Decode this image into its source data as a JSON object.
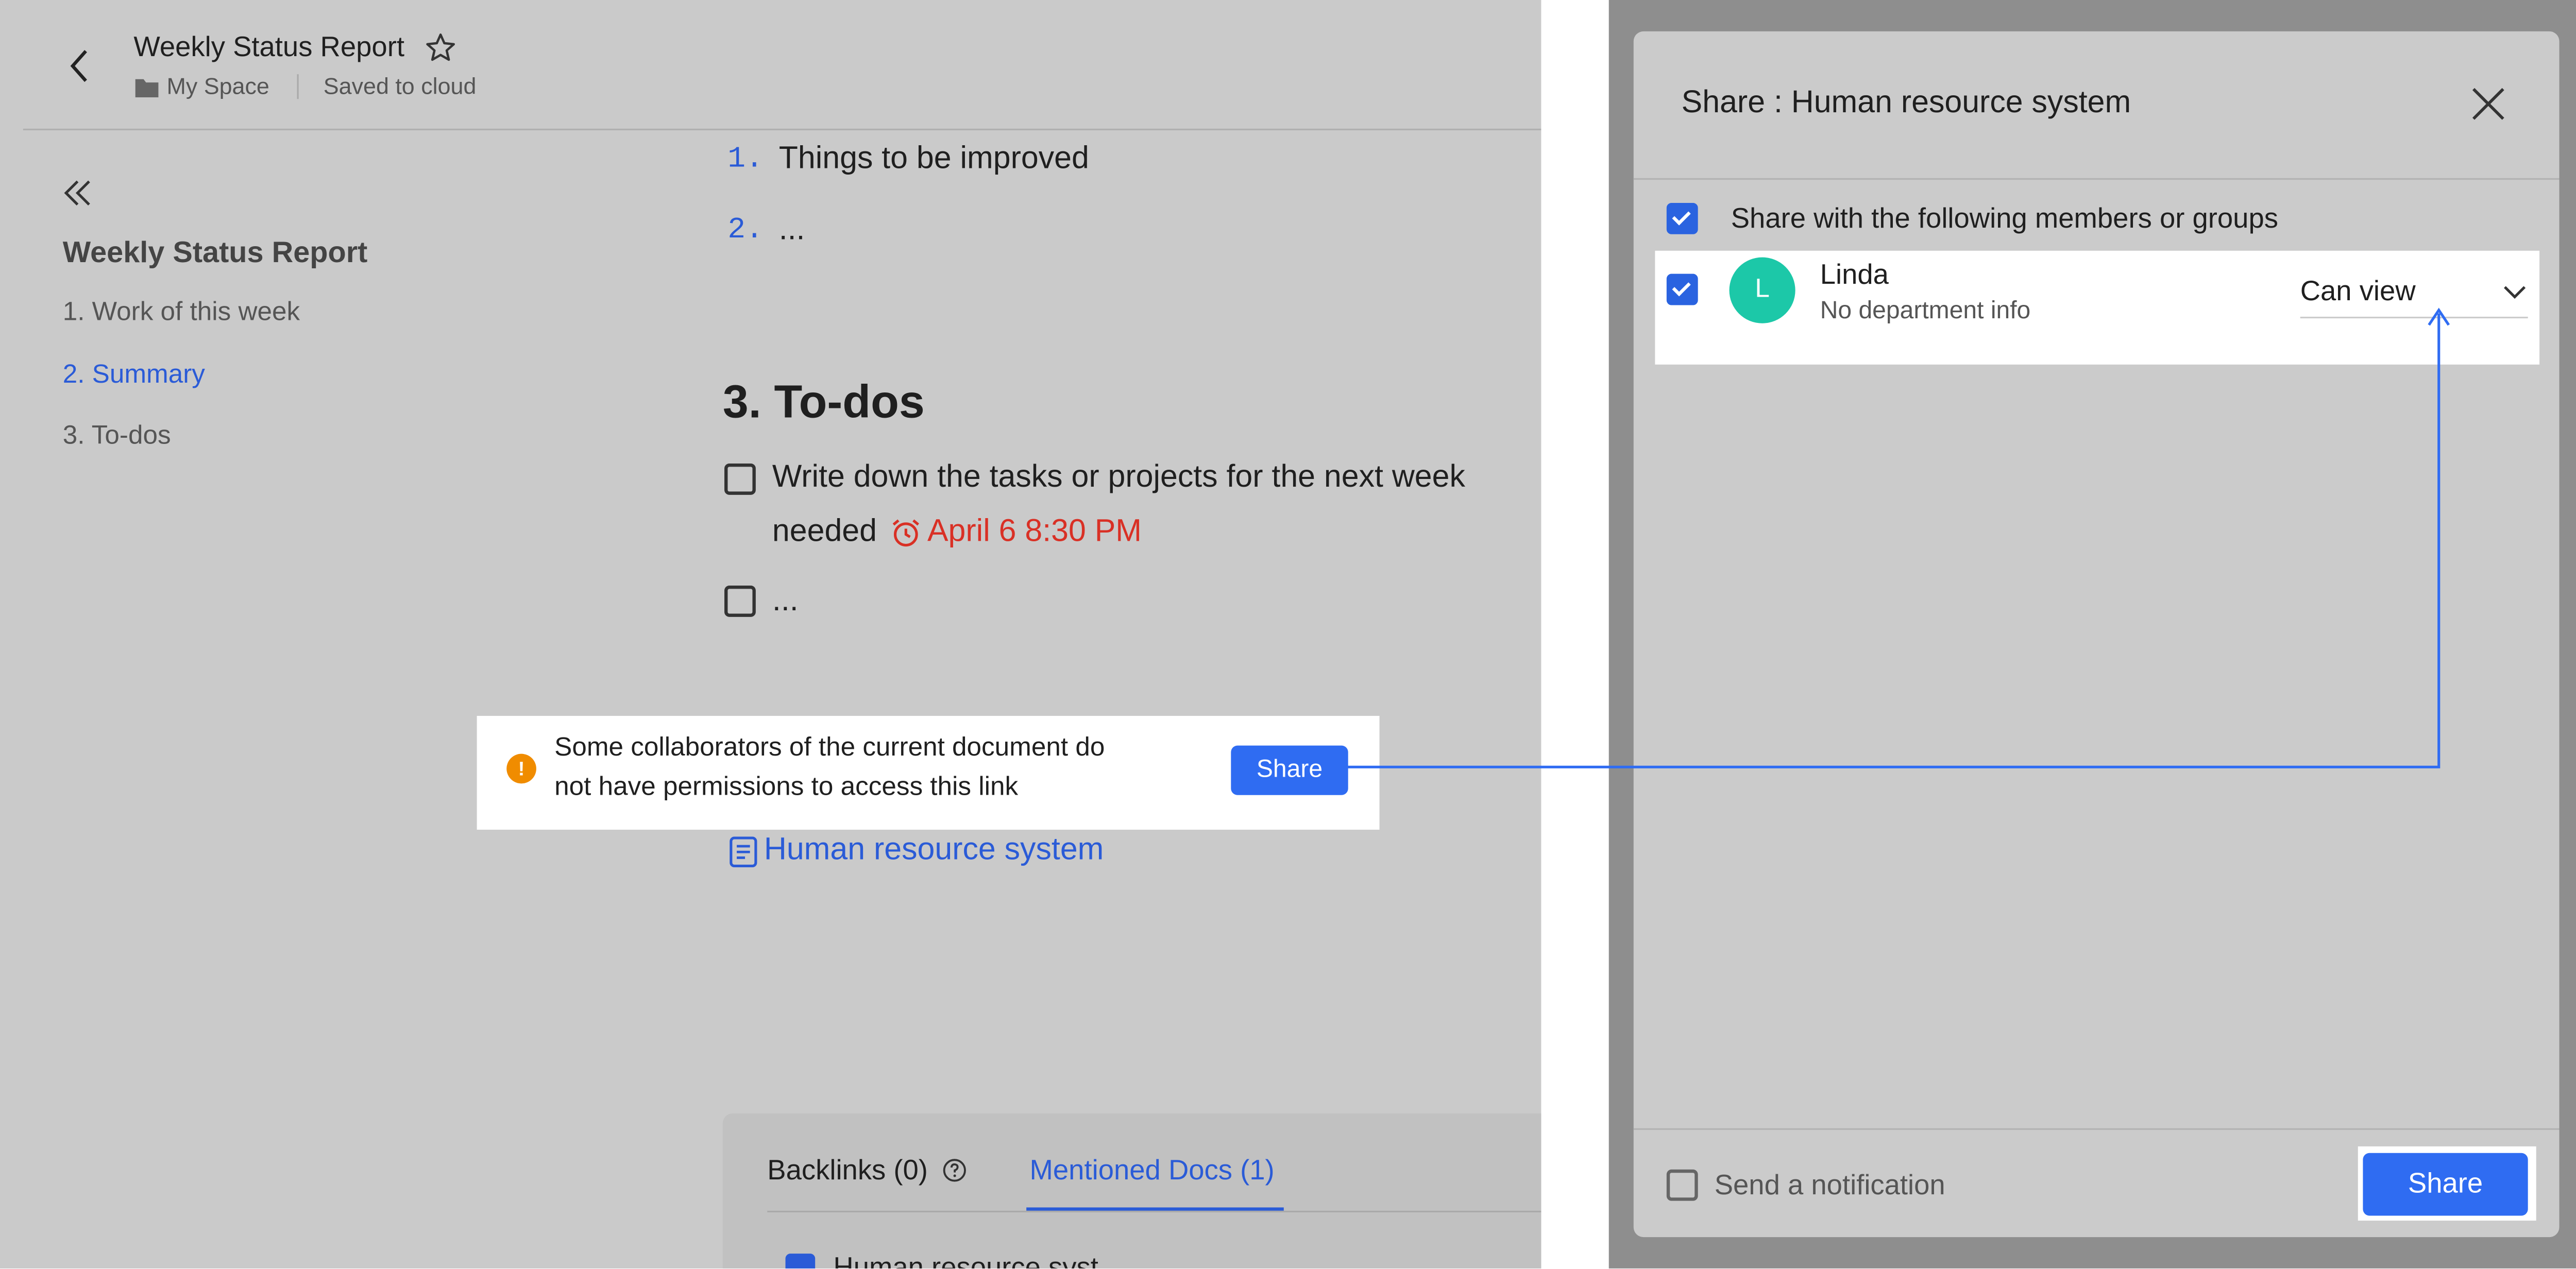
{
  "header": {
    "title": "Weekly Status Report",
    "breadcrumb_space": "My Space",
    "save_status": "Saved to cloud"
  },
  "outline": {
    "title": "Weekly Status Report",
    "items": [
      {
        "label": "1. Work of this week"
      },
      {
        "label": "2. Summary"
      },
      {
        "label": "3. To-dos"
      }
    ]
  },
  "content": {
    "list_items": [
      {
        "num": "1.",
        "text": "Things to be improved"
      },
      {
        "num": "2.",
        "text": "..."
      }
    ],
    "section_heading": "3. To-dos",
    "todos": [
      {
        "line1": "Write down the tasks or projects for the next week",
        "line2": "needed",
        "reminder": "April 6 8:30 PM"
      },
      {
        "line1": "..."
      }
    ],
    "doc_link": "Human resource system"
  },
  "tooltip": {
    "message_line1": "Some collaborators of the current document do",
    "message_line2": "not have permissions to access this link",
    "button": "Share"
  },
  "bottom_tabs": {
    "backlinks": "Backlinks (0)",
    "mentioned": "Mentioned Docs (1)",
    "row_partial": "Human resource syst..."
  },
  "share_dialog": {
    "title": "Share : Human resource system",
    "share_with_label": "Share with the following members or groups",
    "member": {
      "avatar_letter": "L",
      "name": "Linda",
      "dept": "No department info",
      "permission": "Can view"
    },
    "notify_label": "Send a notification",
    "share_button": "Share"
  },
  "colors": {
    "accent": "#2f6cf2",
    "reminder": "#d93025",
    "warning": "#f08c00",
    "avatar": "#1cc8a8"
  }
}
